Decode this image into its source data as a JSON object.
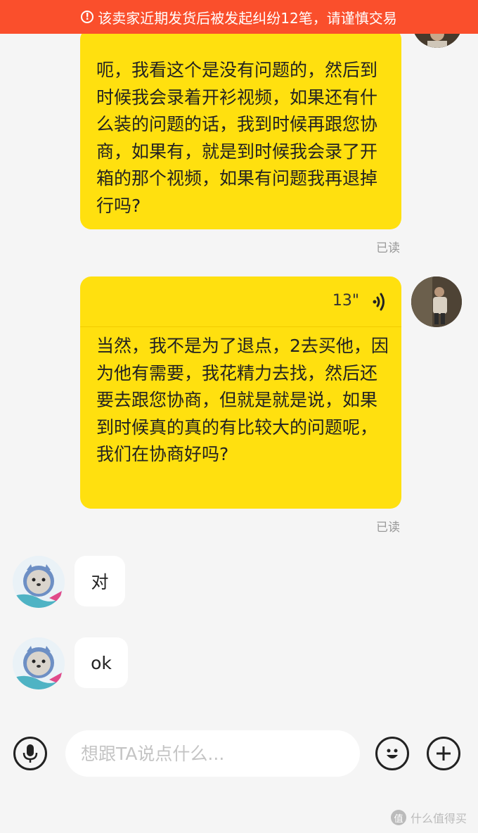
{
  "banner": {
    "icon": "exclamation-circle-icon",
    "text": "该卖家近期发货后被发起纠纷12笔，请谨慎交易"
  },
  "messages": [
    {
      "text": "呃，我看这个是没有问题的，然后到时候我会录着开衫视频，如果还有什么装的问题的话，我到时候再跟您协商，如果有，就是到时候我会录了开箱的那个视频，如果有问题我再退掉行吗?",
      "status": "已读"
    },
    {
      "voice_duration": "13\"",
      "text": "当然，我不是为了退点，2去买他，因为他有需要，我花精力去找，然后还要去跟您协商，但就是就是说，如果到时候真的真的有比较大的问题呢，我们在协商好吗?",
      "status": "已读"
    },
    {
      "text": "对"
    },
    {
      "text": "ok"
    }
  ],
  "input": {
    "placeholder": "想跟TA说点什么..."
  },
  "toolbar": {
    "mic_icon": "microphone-icon",
    "emoji_icon": "emoji-icon",
    "plus_icon": "plus-icon"
  },
  "watermark": {
    "logo": "值",
    "text": "什么值得买"
  }
}
